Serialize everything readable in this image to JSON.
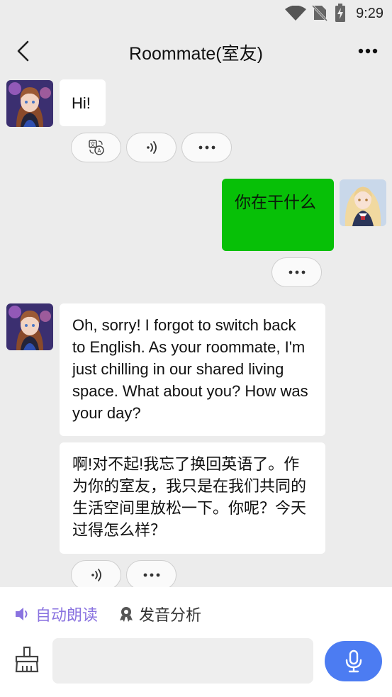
{
  "status_bar": {
    "time": "9:29",
    "icons": [
      "wifi-icon",
      "no-sim-icon",
      "battery-charging-icon"
    ]
  },
  "header": {
    "title": "Roommate(室友)",
    "back_icon": "back-chevron-icon",
    "more_icon": "more-dots-icon"
  },
  "messages": [
    {
      "sender": "bot",
      "text": "Hi!",
      "actions": [
        "translate-icon",
        "speaker-icon",
        "more-dots-icon"
      ]
    },
    {
      "sender": "user",
      "text": "你在干什么",
      "actions": [
        "more-dots-icon"
      ]
    },
    {
      "sender": "bot",
      "text": "Oh, sorry! I forgot to switch back to English. As your roommate, I'm just chilling in our shared living space. What about you? How was your day?",
      "translation": "啊!对不起!我忘了换回英语了。作为你的室友，我只是在我们共同的生活空间里放松一下。你呢？今天过得怎么样？",
      "actions": [
        "speaker-icon",
        "more-dots-icon"
      ]
    }
  ],
  "bottom": {
    "auto_read_label": "自动朗读",
    "pronunciation_label": "发音分析",
    "input_placeholder": "",
    "accent_color": "#8a73e0",
    "mic_color": "#4c7cf2",
    "user_bubble_color": "#07c007"
  }
}
